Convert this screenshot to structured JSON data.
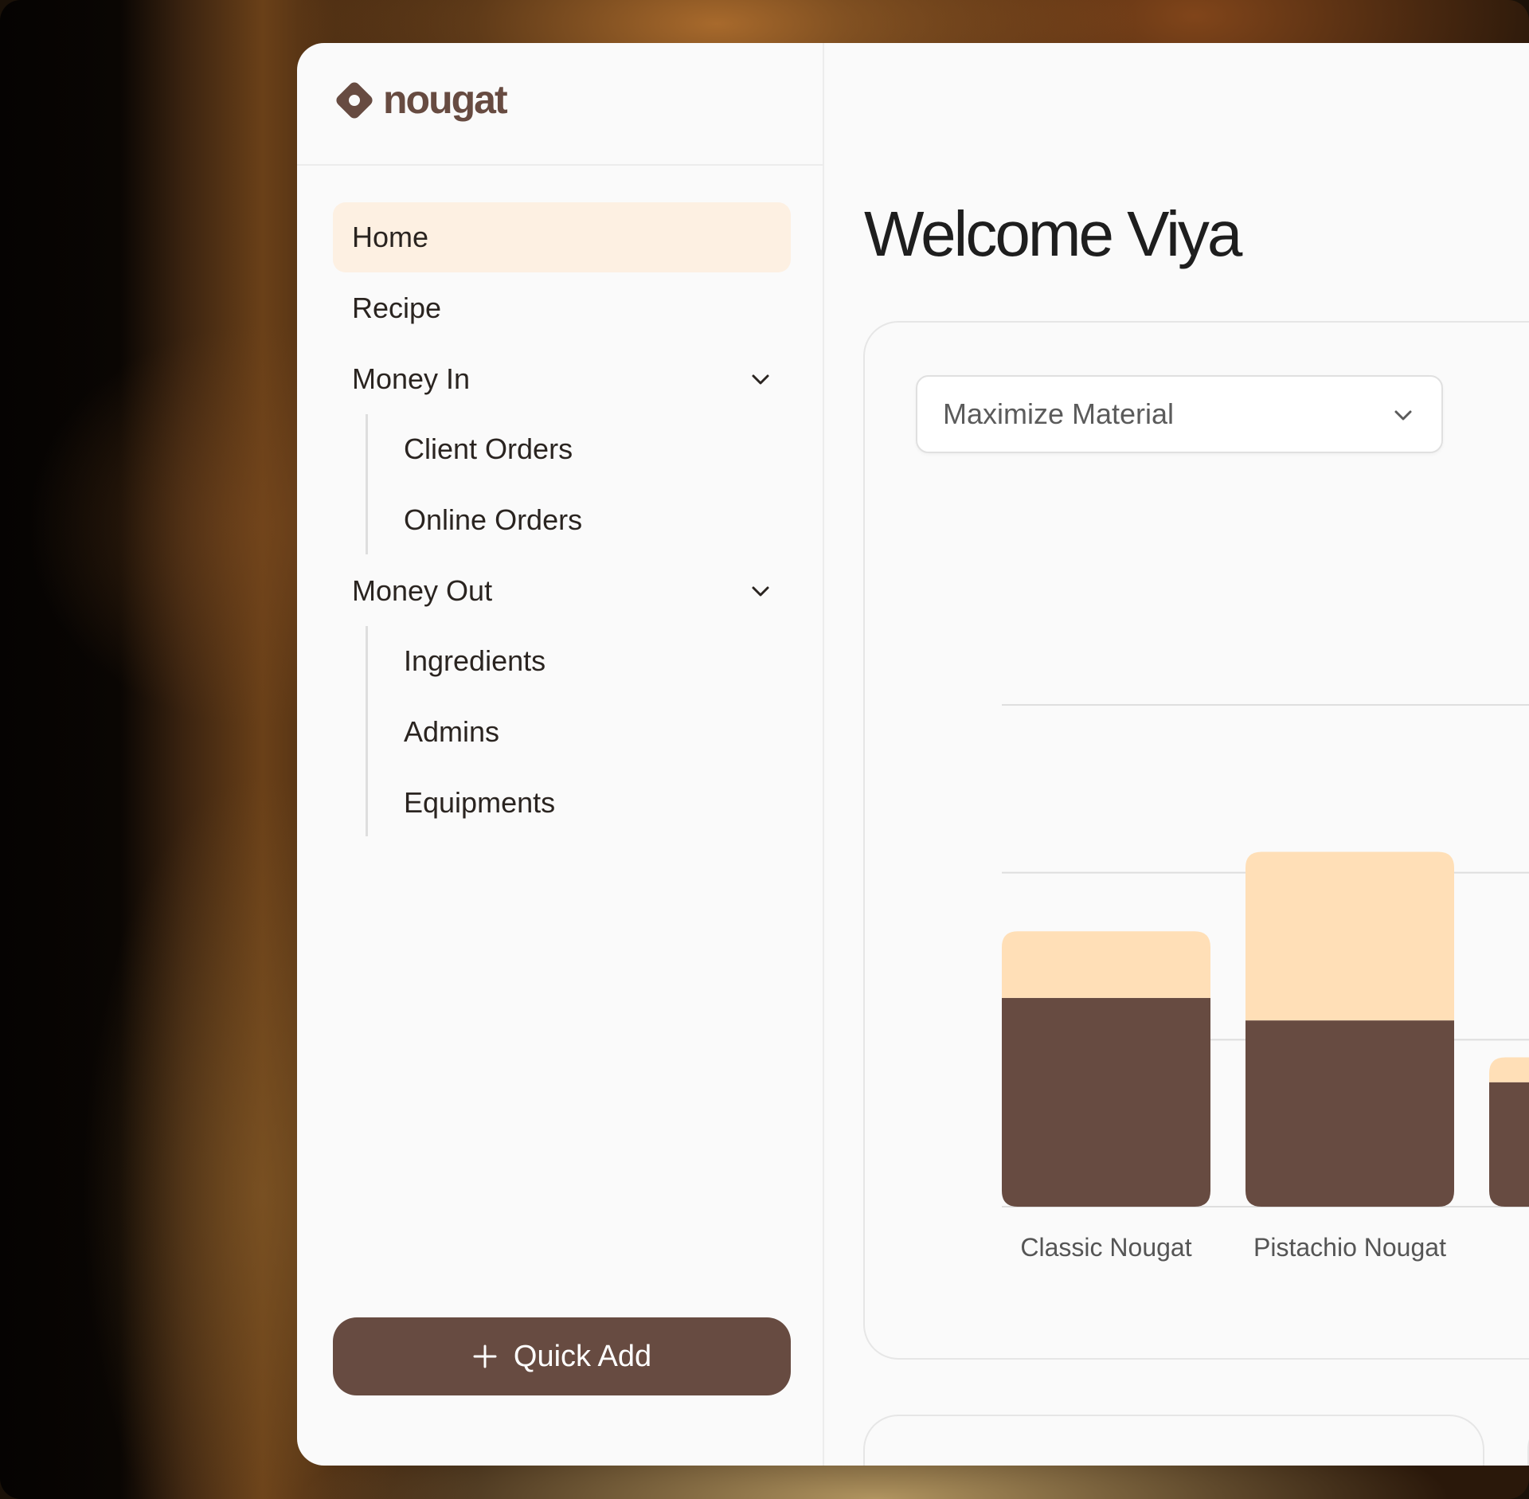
{
  "brand": {
    "name": "nougat",
    "color": "#674b41"
  },
  "sidebar": {
    "items": [
      {
        "label": "Home",
        "active": true
      },
      {
        "label": "Recipe"
      },
      {
        "label": "Money In",
        "expanded": true,
        "children": [
          "Client Orders",
          "Online Orders"
        ]
      },
      {
        "label": "Money Out",
        "expanded": true,
        "children": [
          "Ingredients",
          "Admins",
          "Equipments"
        ]
      }
    ],
    "quick_add_label": "Quick Add"
  },
  "main": {
    "welcome": "Welcome Viya",
    "dropdown": {
      "selected": "Maximize Material"
    }
  },
  "colors": {
    "accent": "#674b41",
    "accent_light": "#ffdfb7",
    "active_bg": "#fdf0e2"
  },
  "chart_data": {
    "type": "bar",
    "stacked": true,
    "categories": [
      "Classic Nougat",
      "Pistachio Nougat",
      ""
    ],
    "series": [
      {
        "values": [
          260,
          232,
          155
        ],
        "color": "#674b41"
      },
      {
        "values": [
          83,
          210,
          31
        ],
        "color": "#ffdfb7"
      }
    ],
    "grid": true,
    "ylim": [
      0,
      625
    ],
    "ticks": [
      0,
      208,
      416,
      625
    ]
  }
}
